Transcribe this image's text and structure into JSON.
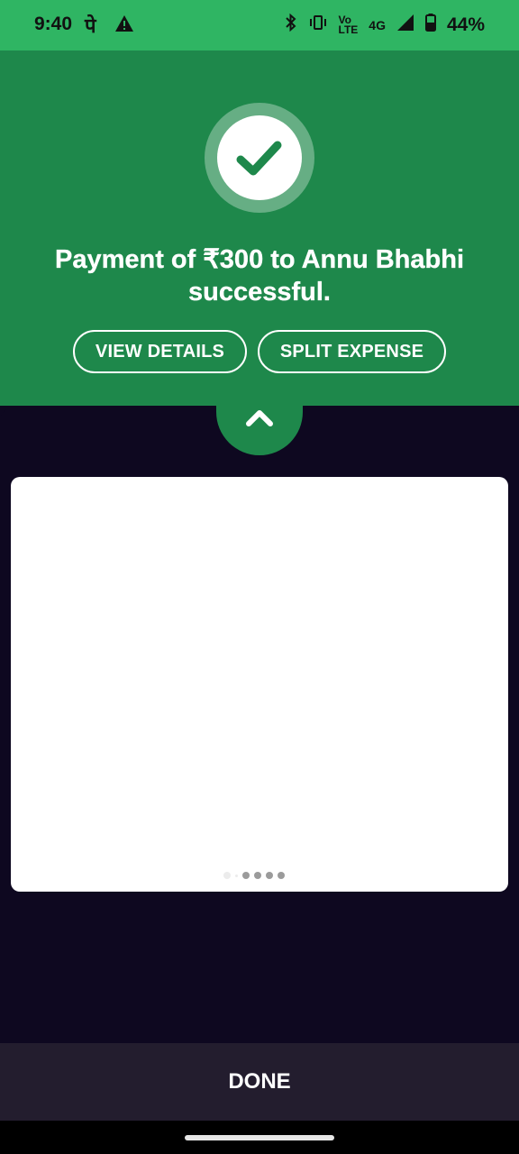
{
  "status_bar": {
    "time": "9:40",
    "hindi_glyph": "पे",
    "net_top": "Vo",
    "net_bottom": "LTE",
    "network": "4G",
    "battery": "44%"
  },
  "payment": {
    "title": "Payment of ₹300 to Annu Bhabhi successful."
  },
  "actions": {
    "view_details": "VIEW DETAILS",
    "split_expense": "SPLIT EXPENSE"
  },
  "footer": {
    "done": "DONE"
  },
  "colors": {
    "status_green": "#2fb563",
    "header_green": "#1e884b",
    "sheet_dark": "#0e0820",
    "done_bar": "#231d2e"
  },
  "icons": [
    "warning-icon",
    "bluetooth-icon",
    "vibrate-icon",
    "signal-icon",
    "battery-icon",
    "checkmark-icon",
    "chevron-up-icon"
  ]
}
